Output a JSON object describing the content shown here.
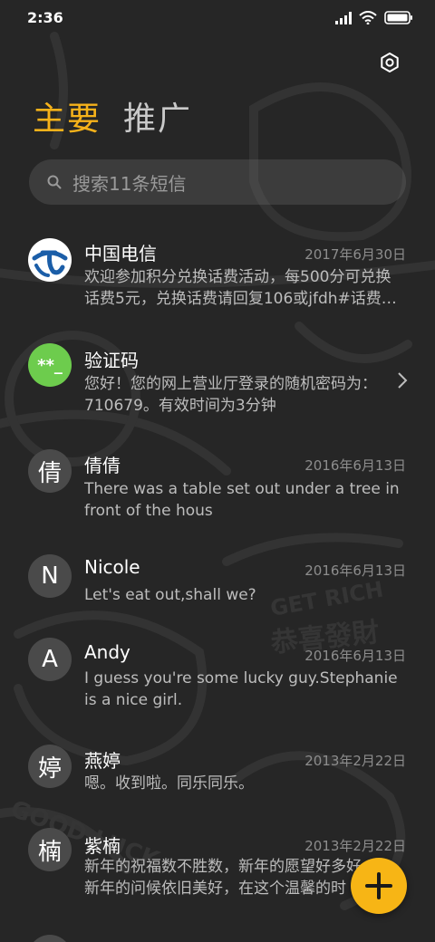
{
  "status_bar": {
    "time": "2:36",
    "icons": [
      "signal-icon",
      "wifi-icon",
      "battery-icon"
    ]
  },
  "header": {
    "settings_icon": "gear-icon",
    "tabs": [
      {
        "label": "主要",
        "active": true
      },
      {
        "label": "推广",
        "active": false
      }
    ]
  },
  "search": {
    "placeholder": "搜索11条短信",
    "icon": "search-icon"
  },
  "colors": {
    "accent": "#f6b21a",
    "background": "#262626",
    "verification_avatar": "#6dcc4d",
    "telecom_blue": "#1b5ea8"
  },
  "messages": [
    {
      "avatar_text": "",
      "avatar_icon": "china-telecom-logo-icon",
      "sender": "中国电信",
      "date": "2017年6月30日",
      "preview_line1": "欢迎参加积分兑换话费活动，每500分可兑换",
      "preview_line2": "话费5元，兑换话费请回复106或jfdh#话费…"
    },
    {
      "avatar_text": "**_",
      "avatar_icon": "verification-code-icon",
      "sender": "验证码",
      "date": "",
      "preview_line1": "您好！您的网上营业厅登录的随机密码为：",
      "preview_line2": "710679。有效时间为3分钟",
      "has_chevron": true
    },
    {
      "avatar_text": "倩",
      "sender": "倩倩",
      "date": "2016年6月13日",
      "preview_line1": "There was a table set out under a tree in",
      "preview_line2": "front of the hous"
    },
    {
      "avatar_text": "N",
      "sender": "Nicole",
      "date": "2016年6月13日",
      "preview_line1": "Let's eat out,shall we?",
      "preview_line2": ""
    },
    {
      "avatar_text": "A",
      "sender": "Andy",
      "date": "2016年6月13日",
      "preview_line1": "I guess you're some lucky guy.Stephanie",
      "preview_line2": "is a nice girl."
    },
    {
      "avatar_text": "婷",
      "sender": "燕婷",
      "date": "2013年2月22日",
      "preview_line1": "嗯。收到啦。同乐同乐。",
      "preview_line2": ""
    },
    {
      "avatar_text": "楠",
      "sender": "紫楠",
      "date": "2013年2月22日",
      "preview_line1": "新年的祝福数不胜数，新年的愿望好多好",
      "preview_line2": "新年的问候依旧美好，在这个温馨的时"
    }
  ],
  "fab": {
    "icon": "plus-icon"
  }
}
